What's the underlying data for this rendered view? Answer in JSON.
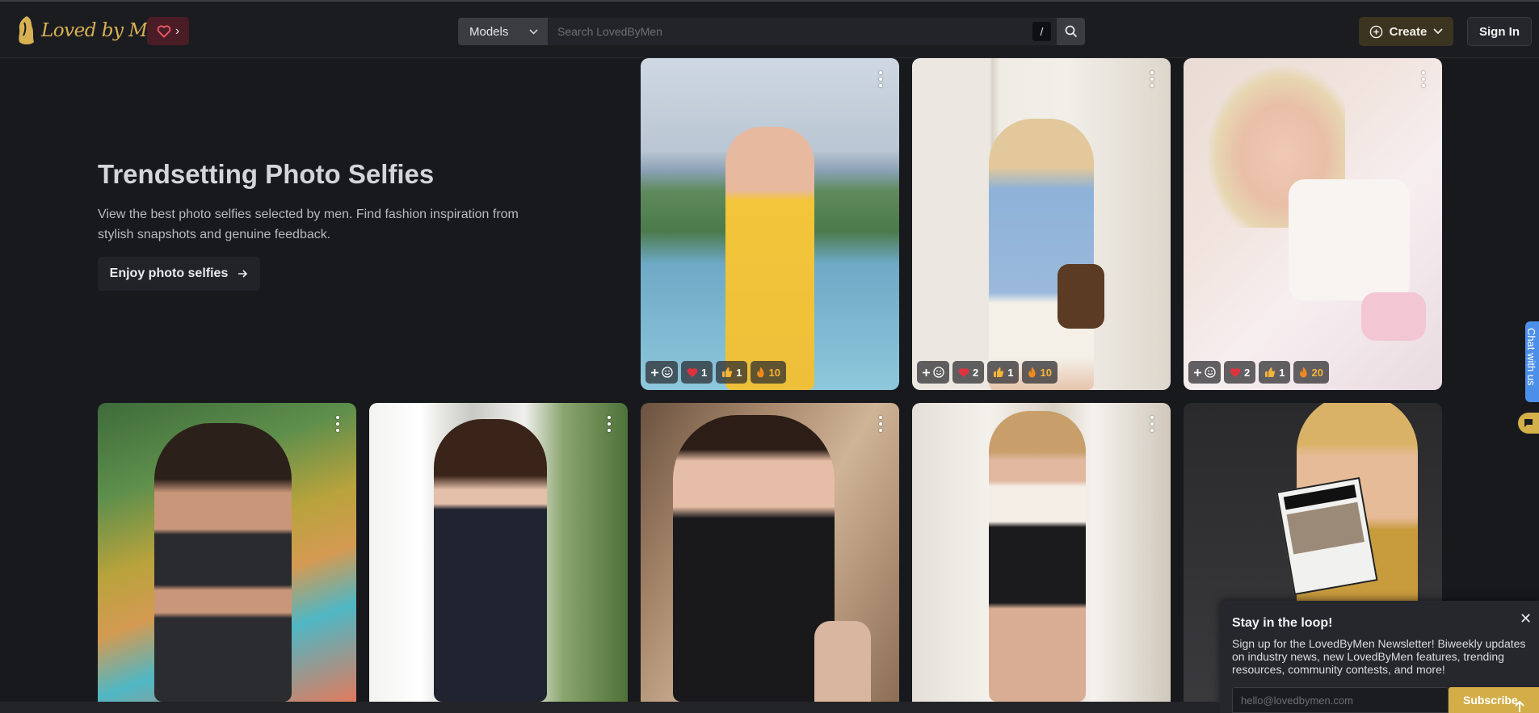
{
  "header": {
    "logo_text": "Loved by Men",
    "models_label": "Models",
    "search_placeholder": "Search LovedByMen",
    "search_shortcut": "/",
    "create_label": "Create",
    "signin_label": "Sign In"
  },
  "hero": {
    "title": "Trendsetting Photo Selfies",
    "description": "View the best photo selfies selected by men. Find fashion inspiration from stylish snapshots and genuine feedback.",
    "cta_label": "Enjoy photo selfies"
  },
  "cards": [
    {
      "reactions": {
        "hearts": "1",
        "likes": "1",
        "fire": "10"
      }
    },
    {
      "reactions": {
        "hearts": "2",
        "likes": "1",
        "fire": "10"
      }
    },
    {
      "reactions": {
        "hearts": "2",
        "likes": "1",
        "fire": "20"
      }
    }
  ],
  "chat": {
    "label": "Chat with us"
  },
  "newsletter": {
    "title": "Stay in the loop!",
    "text": "Sign up for the LovedByMen Newsletter! Biweekly updates on industry news, new LovedByMen features, trending resources, community contests, and more!",
    "email_placeholder": "hello@lovedbymen.com",
    "submit_label": "Subscribe"
  },
  "colors": {
    "background": "#18191d",
    "accent_gold": "#d3ad48",
    "heart_red": "#e0323e"
  }
}
